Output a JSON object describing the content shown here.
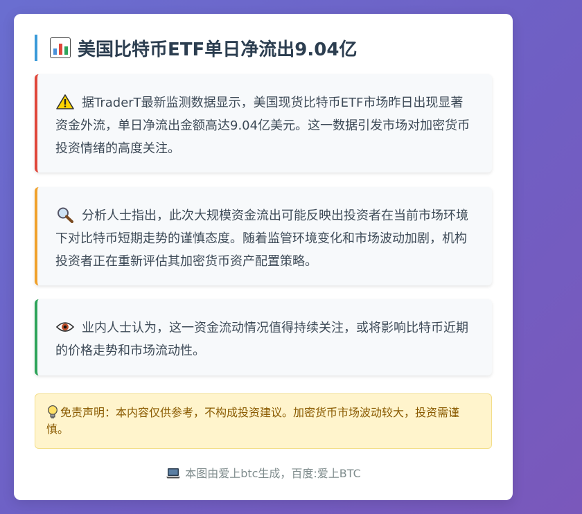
{
  "header": {
    "title": "美国比特币ETF单日净流出9.04亿",
    "icon": "bar-chart-icon"
  },
  "sections": [
    {
      "icon": "warning-icon",
      "accent": "#e0473b",
      "text": "据TraderT最新监测数据显示，美国现货比特币ETF市场昨日出现显著资金外流，单日净流出金额高达9.04亿美元。这一数据引发市场对加密货币投资情绪的高度关注。"
    },
    {
      "icon": "magnifier-icon",
      "accent": "#f0a12b",
      "text": "分析人士指出，此次大规模资金流出可能反映出投资者在当前市场环境下对比特币短期走势的谨慎态度。随着监管环境变化和市场波动加剧，机构投资者正在重新评估其加密货币资产配置策略。"
    },
    {
      "icon": "eye-icon",
      "accent": "#2ea45a",
      "text": "业内人士认为，这一资金流动情况值得持续关注，或将影响比特币近期的价格走势和市场流动性。"
    }
  ],
  "disclaimer": {
    "icon": "lightbulb-icon",
    "text": "免责声明：本内容仅供参考，不构成投资建议。加密货币市场波动较大，投资需谨慎。"
  },
  "footer": {
    "icon": "laptop-icon",
    "text": "本图由爱上btc生成，百度:爱上BTC"
  },
  "colors": {
    "background_from": "#6a6ed0",
    "background_to": "#7a58bb",
    "title_bar": "#3a9ad9",
    "disclaimer_bg": "#fff4cc"
  }
}
